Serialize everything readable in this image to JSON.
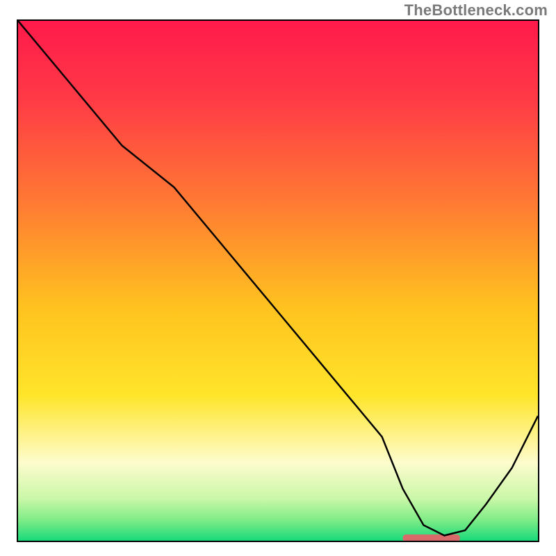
{
  "watermark": "TheBottleneck.com",
  "chart_data": {
    "type": "line",
    "title": "",
    "xlabel": "",
    "ylabel": "",
    "xlim": [
      0,
      100
    ],
    "ylim": [
      0,
      100
    ],
    "grid": false,
    "legend": false,
    "gradient_stops": [
      {
        "offset": 0.0,
        "color": "#ff1a4b"
      },
      {
        "offset": 0.15,
        "color": "#ff3a46"
      },
      {
        "offset": 0.35,
        "color": "#ff7a33"
      },
      {
        "offset": 0.55,
        "color": "#ffc21f"
      },
      {
        "offset": 0.72,
        "color": "#ffe52a"
      },
      {
        "offset": 0.85,
        "color": "#fdfccd"
      },
      {
        "offset": 0.92,
        "color": "#c9f7a7"
      },
      {
        "offset": 0.96,
        "color": "#7fec87"
      },
      {
        "offset": 1.0,
        "color": "#18da7b"
      }
    ],
    "series": [
      {
        "name": "bottleneck-curve",
        "x": [
          0,
          10,
          20,
          30,
          40,
          50,
          60,
          70,
          74,
          78,
          82,
          86,
          90,
          95,
          100
        ],
        "y": [
          100,
          88,
          76,
          68,
          56,
          44,
          32,
          20,
          10,
          3,
          1,
          2,
          7,
          14,
          24
        ]
      }
    ],
    "marker": {
      "name": "optimal-range",
      "x_start": 74,
      "x_end": 85,
      "y": 0.5,
      "color": "#d86a6a"
    }
  }
}
